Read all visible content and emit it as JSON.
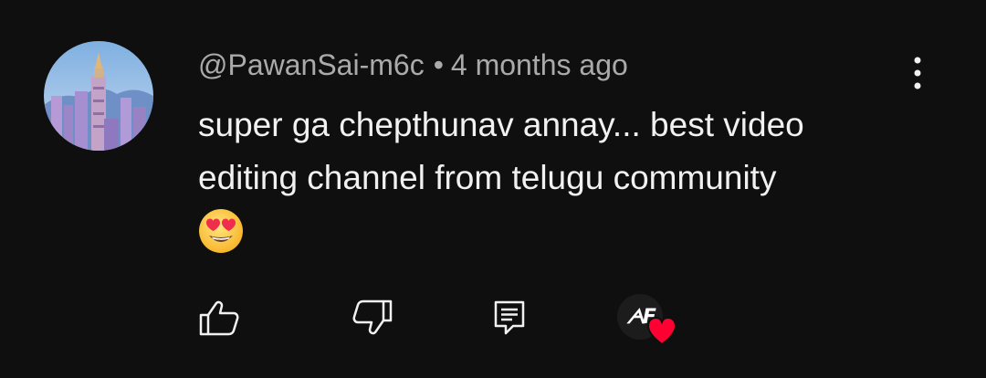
{
  "comment": {
    "author": "@PawanSai-m6c",
    "separator": "•",
    "time": "4 months ago",
    "text_line1": "super ga chepthunav annay... best video",
    "text_line2": "editing channel from telugu community",
    "emoji": "smiling-face-with-heart-eyes"
  },
  "icons": {
    "avatar": "city-tower-avatar",
    "more": "more-vertical-icon",
    "like": "thumbs-up-icon",
    "dislike": "thumbs-down-icon",
    "reply": "comment-reply-icon",
    "creator_heart": "creator-heart-icon"
  },
  "creator": {
    "badge": "ᗅF"
  },
  "colors": {
    "background": "#0f0f0f",
    "text": "#f1f1f1",
    "meta": "#aaaaaa",
    "heart": "#ff0033"
  }
}
